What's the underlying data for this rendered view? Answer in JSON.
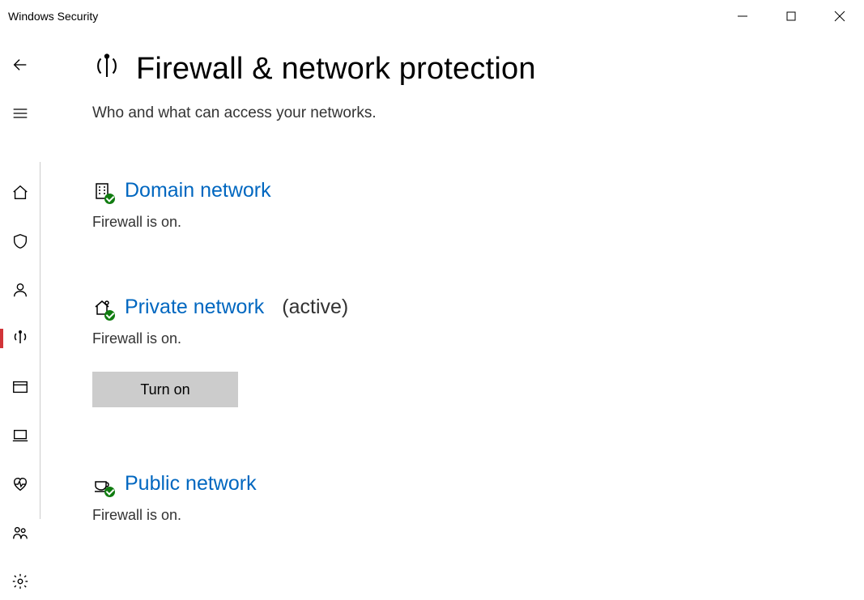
{
  "window": {
    "title": "Windows Security"
  },
  "page": {
    "title": "Firewall & network protection",
    "subtitle": "Who and what can access your networks."
  },
  "sections": {
    "domain": {
      "label": "Domain network",
      "status": "Firewall is on."
    },
    "private": {
      "label": "Private network",
      "suffix": "(active)",
      "status": "Firewall is on.",
      "button": "Turn on"
    },
    "public": {
      "label": "Public network",
      "status": "Firewall is on."
    }
  }
}
